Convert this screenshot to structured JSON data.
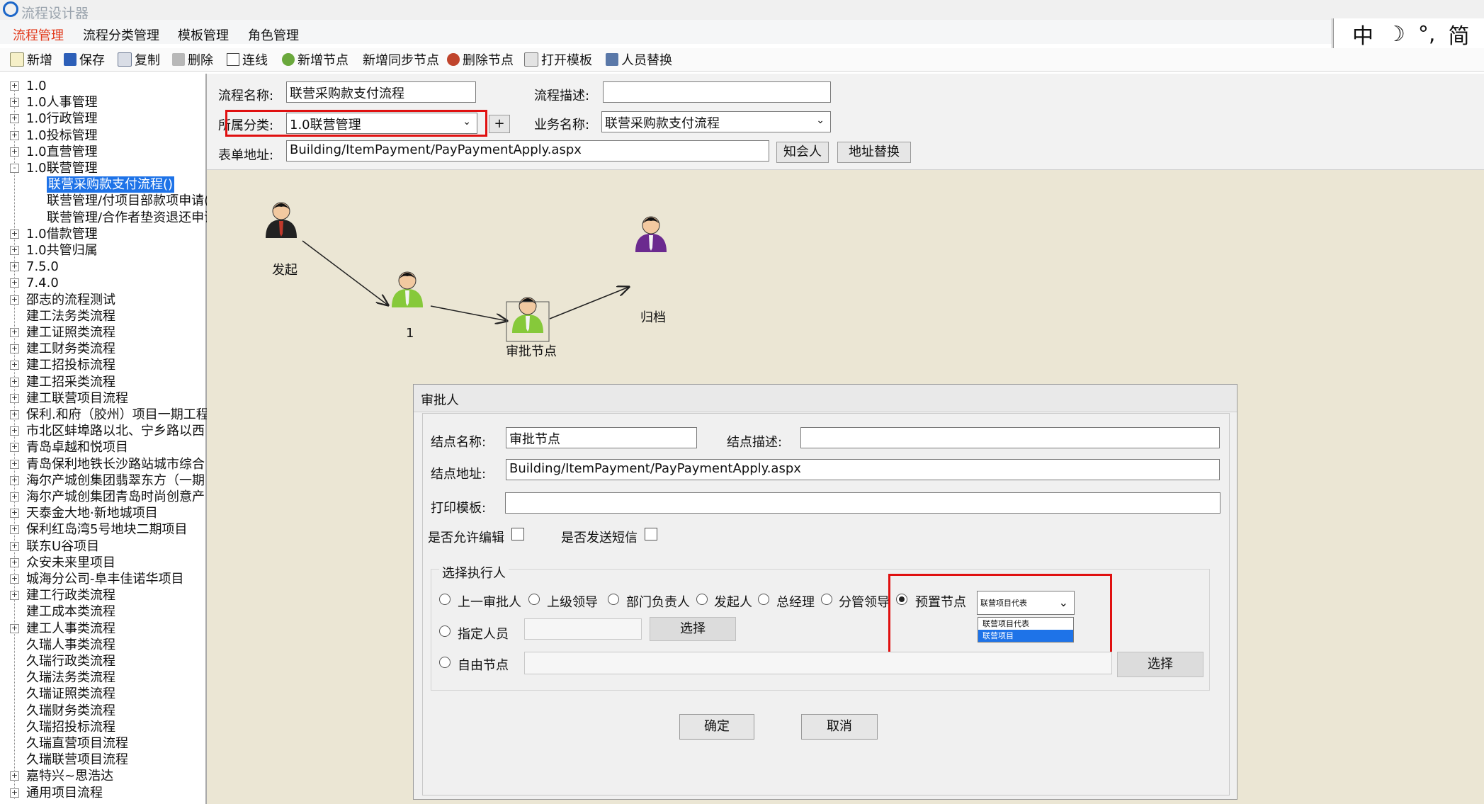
{
  "app": {
    "title": "流程设计器"
  },
  "menu": {
    "items": [
      "流程管理",
      "流程分类管理",
      "模板管理",
      "角色管理"
    ],
    "active_index": 0
  },
  "ime": {
    "items": [
      "中",
      "☽",
      "°,",
      "简"
    ]
  },
  "toolbar": {
    "new": "新增",
    "save": "保存",
    "copy": "复制",
    "delete": "删除",
    "connect": "连线",
    "add_node": "新增节点",
    "add_sync_node": "新增同步节点",
    "delete_node": "删除节点",
    "open_template": "打开模板",
    "replace_person": "人员替换"
  },
  "tree": {
    "items": [
      {
        "label": "1.0",
        "expander": "+"
      },
      {
        "label": "1.0人事管理",
        "expander": "+"
      },
      {
        "label": "1.0行政管理",
        "expander": "+"
      },
      {
        "label": "1.0投标管理",
        "expander": "+"
      },
      {
        "label": "1.0直营管理",
        "expander": "+"
      },
      {
        "label": "1.0联营管理",
        "expander": "-"
      },
      {
        "label": "联营采购款支付流程()",
        "child": true,
        "selected": true
      },
      {
        "label": "联营管理/付项目部款项申请(",
        "child": true
      },
      {
        "label": "联营管理/合作者垫资退还申请",
        "child": true
      },
      {
        "label": "1.0借款管理",
        "expander": "+"
      },
      {
        "label": "1.0共管归属",
        "expander": "+"
      },
      {
        "label": "7.5.0",
        "expander": "+"
      },
      {
        "label": "7.4.0",
        "expander": "+"
      },
      {
        "label": "邵志的流程测试",
        "expander": "+"
      },
      {
        "label": "建工法务类流程",
        "expander": ""
      },
      {
        "label": "建工证照类流程",
        "expander": "+"
      },
      {
        "label": "建工财务类流程",
        "expander": "+"
      },
      {
        "label": "建工招投标流程",
        "expander": "+"
      },
      {
        "label": "建工招采类流程",
        "expander": "+"
      },
      {
        "label": "建工联营项目流程",
        "expander": "+"
      },
      {
        "label": "保利.和府（胶州）项目一期工程",
        "expander": "+"
      },
      {
        "label": "市北区蚌埠路以北、宁乡路以西",
        "expander": "+"
      },
      {
        "label": "青岛卓越和悦项目",
        "expander": "+"
      },
      {
        "label": "青岛保利地铁长沙路站城市综合",
        "expander": "+"
      },
      {
        "label": "海尔产城创集团翡翠东方（一期",
        "expander": "+"
      },
      {
        "label": "海尔产城创集团青岛时尚创意产",
        "expander": "+"
      },
      {
        "label": "天泰金大地·新地城项目",
        "expander": "+"
      },
      {
        "label": "保利红岛湾5号地块二期项目",
        "expander": "+"
      },
      {
        "label": "联东U谷项目",
        "expander": "+"
      },
      {
        "label": "众安未来里项目",
        "expander": "+"
      },
      {
        "label": "城海分公司-阜丰佳诺华项目",
        "expander": "+"
      },
      {
        "label": "建工行政类流程",
        "expander": "+"
      },
      {
        "label": "建工成本类流程",
        "expander": ""
      },
      {
        "label": "建工人事类流程",
        "expander": "+"
      },
      {
        "label": "久瑞人事类流程",
        "expander": ""
      },
      {
        "label": "久瑞行政类流程",
        "expander": ""
      },
      {
        "label": "久瑞法务类流程",
        "expander": ""
      },
      {
        "label": "久瑞证照类流程",
        "expander": ""
      },
      {
        "label": "久瑞财务类流程",
        "expander": ""
      },
      {
        "label": "久瑞招投标流程",
        "expander": ""
      },
      {
        "label": "久瑞直营项目流程",
        "expander": ""
      },
      {
        "label": "久瑞联营项目流程",
        "expander": ""
      },
      {
        "label": "嘉特兴~思浩达",
        "expander": "+"
      },
      {
        "label": "通用项目流程",
        "expander": "+"
      }
    ]
  },
  "form": {
    "name_label": "流程名称:",
    "name_value": "联营采购款支付流程",
    "desc_label": "流程描述:",
    "desc_value": "",
    "category_label": "所属分类:",
    "category_value": "1.0联营管理",
    "add_btn": "+",
    "business_label": "业务名称:",
    "business_value": "联营采购款支付流程",
    "url_label": "表单地址:",
    "url_value": "Building/ItemPayment/PayPaymentApply.aspx",
    "notify_btn": "知会人",
    "replace_btn": "地址替换"
  },
  "flow": {
    "nodes": [
      {
        "label": "发起",
        "color": "#222222"
      },
      {
        "label": "1",
        "color": "#86c93a"
      },
      {
        "label": "审批节点",
        "color": "#86c93a"
      },
      {
        "label": "归档",
        "color": "#6b2a8f"
      }
    ]
  },
  "dialog": {
    "title": "审批人",
    "node_name_label": "结点名称:",
    "node_name_value": "审批节点",
    "node_desc_label": "结点描述:",
    "node_desc_value": "",
    "node_url_label": "结点地址:",
    "node_url_value": "Building/ItemPayment/PayPaymentApply.aspx",
    "print_label": "打印模板:",
    "print_value": "",
    "allow_edit_label": "是否允许编辑",
    "send_sms_label": "是否发送短信",
    "group_label": "选择执行人",
    "radios": [
      "上一审批人",
      "上级领导",
      "部门负责人",
      "发起人",
      "总经理",
      "分管领导",
      "预置节点"
    ],
    "preset_selected": "联营项目代表",
    "preset_options": [
      "联营项目代表",
      "联营项目"
    ],
    "preset_highlight": 1,
    "assign_label": "指定人员",
    "select_btn": "选择",
    "free_label": "自由节点",
    "select_btn2": "选择",
    "ok_btn": "确定",
    "cancel_btn": "取消"
  },
  "colors": {
    "highlight_box": "#e01010",
    "selection": "#1e73e8",
    "canvas": "#ebe6d4",
    "active_menu": "#e23b1d"
  }
}
